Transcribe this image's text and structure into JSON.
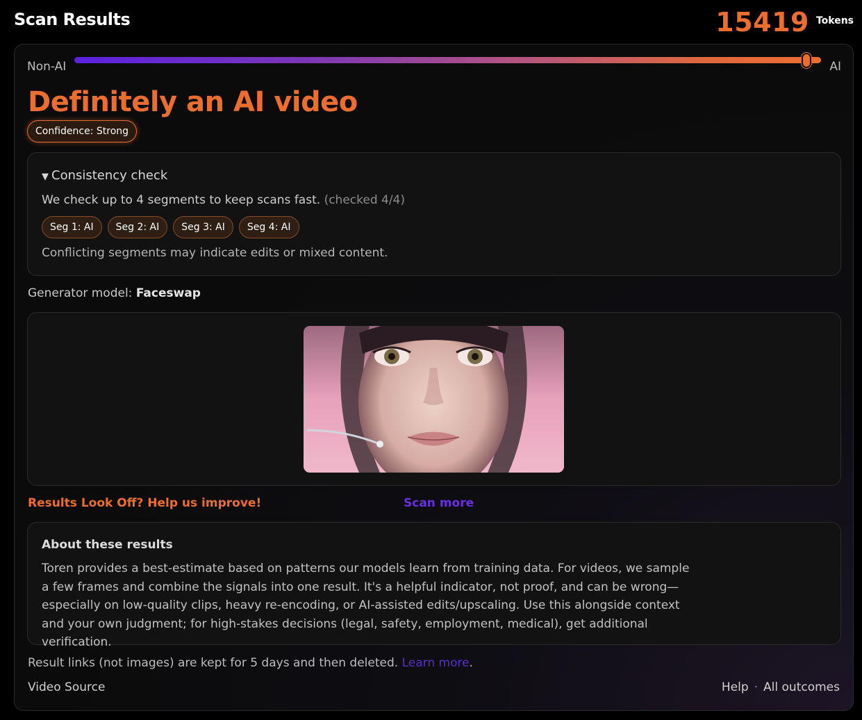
{
  "header": {
    "title": "Scan Results",
    "tokens_count": "15419",
    "tokens_label": "Tokens"
  },
  "meter": {
    "left_label": "Non-AI",
    "right_label": "AI",
    "value_fraction": 0.98
  },
  "verdict": {
    "headline": "Definitely an AI video",
    "confidence": "Confidence: Strong"
  },
  "consistency": {
    "title": "Consistency check",
    "description": "We check up to 4 segments to keep scans fast.",
    "checked": "(checked 4/4)",
    "segments": [
      "Seg 1: AI",
      "Seg 2: AI",
      "Seg 3: AI",
      "Seg 4: AI"
    ],
    "note": "Conflicting segments may indicate edits or mixed content."
  },
  "generator": {
    "label": "Generator model:",
    "value": "Faceswap"
  },
  "actions": {
    "feedback": "Results Look Off? Help us improve!",
    "scan_more": "Scan more"
  },
  "about": {
    "title": "About these results",
    "text": "Toren provides a best-estimate based on patterns our models learn from training data. For videos, we sample a few frames and combine the signals into one result. It's a helpful indicator, not proof, and can be wrong—especially on low-quality clips, heavy re-encoding, or AI-assisted edits/upscaling. Use this alongside context and your own judgment; for high-stakes decisions (legal, safety, employment, medical), get additional verification."
  },
  "retention": {
    "text": "Result links (not images) are kept for 5 days and then deleted.",
    "link": "Learn more",
    "suffix": "."
  },
  "footer": {
    "video_source": "Video Source",
    "help": "Help",
    "separator": "·",
    "all_outcomes": "All outcomes"
  },
  "colors": {
    "accent": "#ec6d30",
    "purple": "#5a22e0",
    "background": "#000000"
  }
}
